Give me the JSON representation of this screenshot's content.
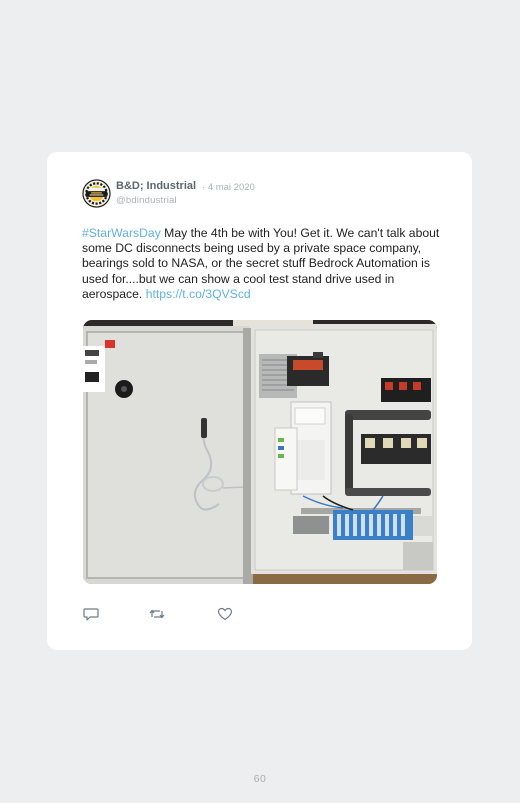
{
  "tweet": {
    "author_name": "B&D; Industrial",
    "date_separator": "·",
    "date": "4 mai 2020",
    "handle": "@bdindustrial",
    "hashtag": "#StarWarsDay",
    "body": " May the 4th be with You! Get it. We can't talk about some DC disconnects being used by a private space company, bearings sold to NASA, or the secret stuff Bedrock Automation is used for....but we can show a cool test stand drive used in aerospace. ",
    "short_link": "https://t.co/3QVScd",
    "avatar_logo_text": "B&D INDUSTRIAL",
    "media_description_icon": "electrical-panel-photo"
  },
  "actions": {
    "reply_icon": "reply-icon",
    "retweet_icon": "retweet-icon",
    "like_icon": "like-icon"
  },
  "footer": {
    "page_number": "60"
  },
  "colors": {
    "background": "#edeef0",
    "card": "#ffffff",
    "link": "#5fb2e4",
    "muted": "#a9b1b8",
    "name": "#5b6770"
  }
}
